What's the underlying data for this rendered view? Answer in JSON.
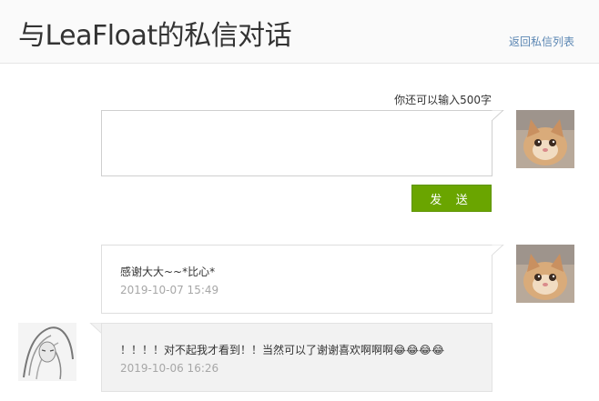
{
  "header": {
    "title": "与LeaFloat的私信对话",
    "back_link": "返回私信列表"
  },
  "composer": {
    "counter": "你还可以输入500字",
    "value": "",
    "send_label": "发 送"
  },
  "messages": [
    {
      "direction": "sent",
      "text": "感谢大大~~*比心*",
      "time": "2019-10-07 15:49"
    },
    {
      "direction": "received",
      "text": "！！！！对不起我才看到！！当然可以了谢谢喜欢啊啊啊😂😂😂😂",
      "time": "2019-10-06 16:26"
    }
  ]
}
